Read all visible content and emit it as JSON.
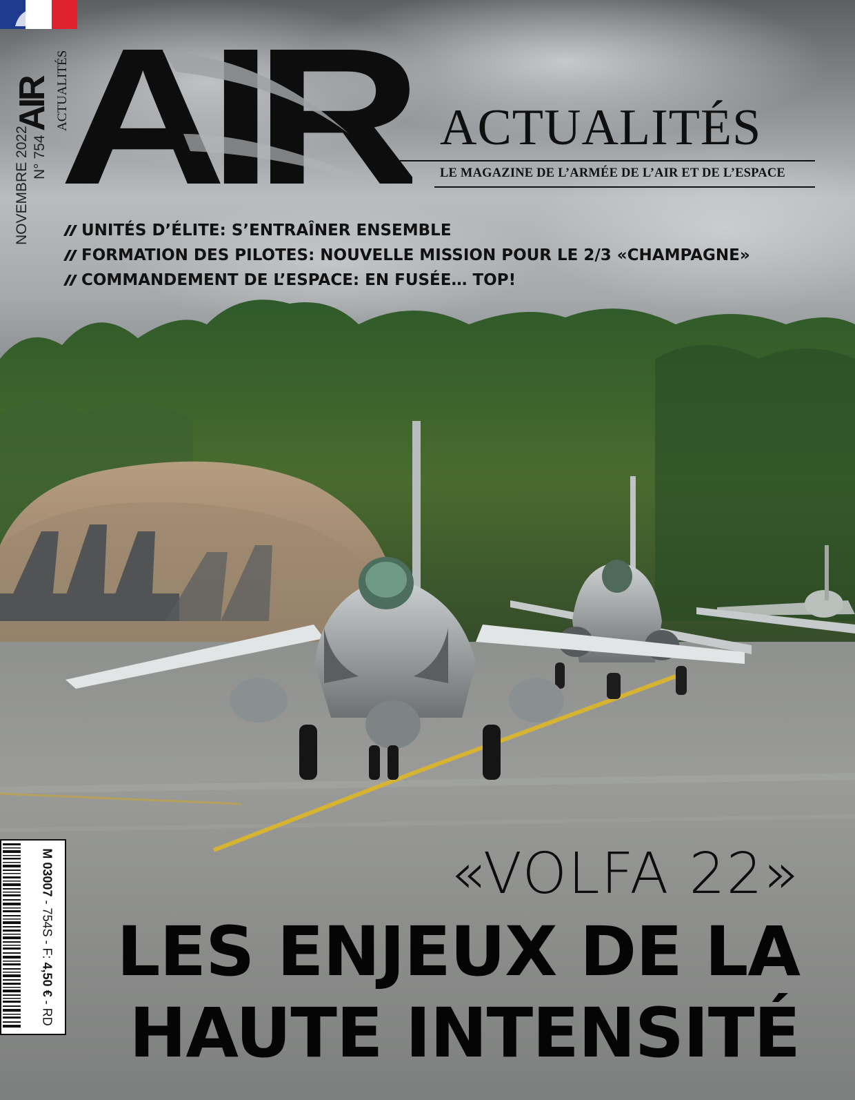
{
  "logo": {
    "main": "AIR",
    "side_main": "AIR",
    "side_sub": "ACTUALITÉS"
  },
  "magazine": {
    "title": "ACTUALITÉS",
    "subtitle": "LE MAGAZINE DE L’ARMÉE DE L’AIR ET DE L’ESPACE",
    "issue_date": "NOVEMBRE 2022",
    "issue_number": "N° 754"
  },
  "headlines": [
    "UNITÉS D’ÉLITE: S’ENTRAÎNER ENSEMBLE",
    "FORMATION DES PILOTES: NOUVELLE MISSION POUR LE 2/3 «CHAMPAGNE»",
    "COMMANDEMENT DE L’ESPACE: EN FUSÉE… TOP!"
  ],
  "cover_story": {
    "quote_title": "«VOLFA 22»",
    "line1": "LES ENJEUX DE LA",
    "line2": "HAUTE INTENSITÉ"
  },
  "barcode": {
    "code": "M 03007",
    "suffix": "- 754S - F:",
    "price": "4,50 €",
    "region": "- RD"
  },
  "colors": {
    "flag_blue": "#1f3b8f",
    "flag_white": "#ffffff",
    "flag_red": "#e1222e",
    "text": "#111111"
  },
  "icons": {
    "headline_marker": "double-slash-icon",
    "flag": "marianne-flag-icon"
  }
}
